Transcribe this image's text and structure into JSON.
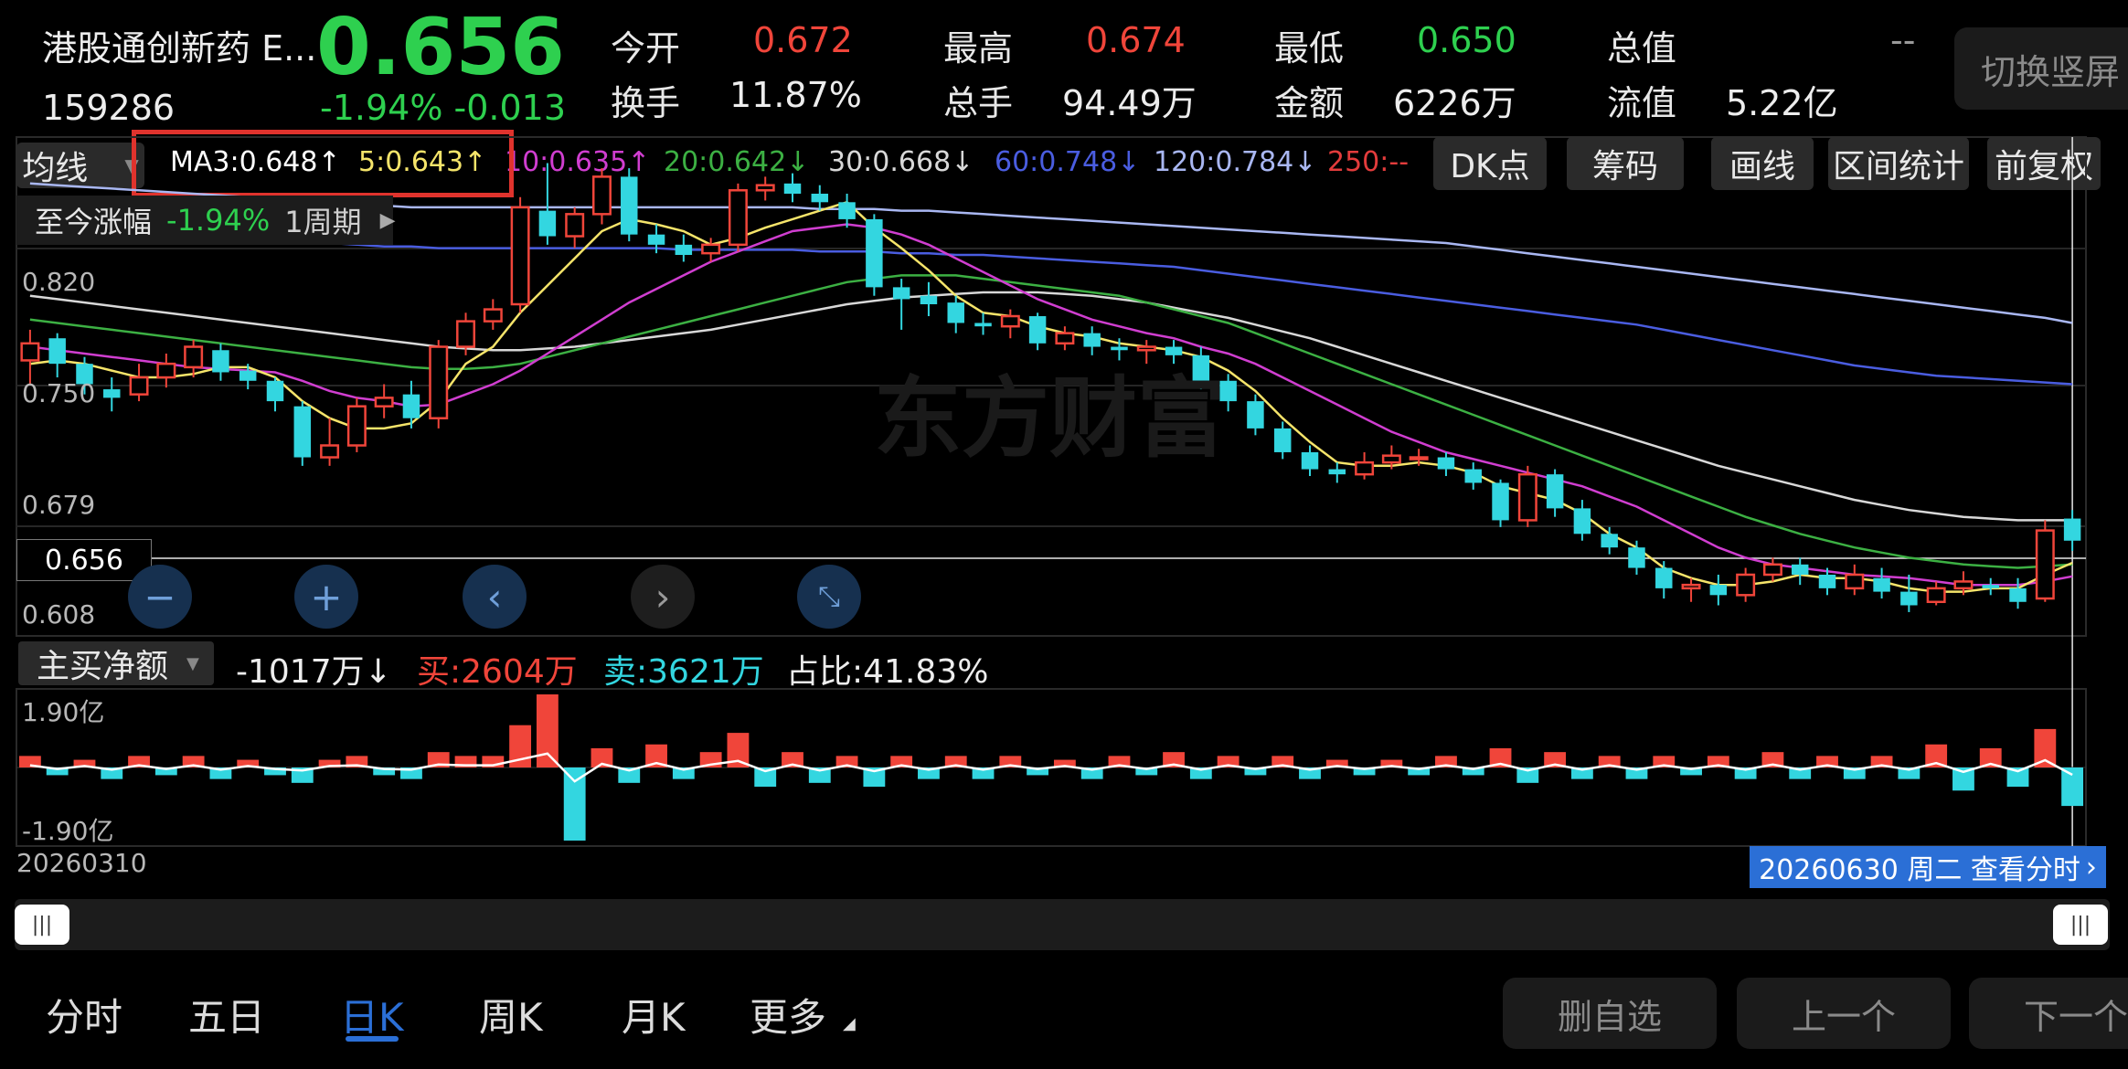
{
  "header": {
    "name": "港股通创新药 E...",
    "code": "159286",
    "price": "0.656",
    "change": "-1.94%  -0.013",
    "stats": [
      {
        "label": "今开",
        "value": "0.672",
        "color": "#f0453a"
      },
      {
        "label": "最高",
        "value": "0.674",
        "color": "#f0453a"
      },
      {
        "label": "最低",
        "value": "0.650",
        "color": "#2ed04f"
      },
      {
        "label": "总值",
        "value": "--",
        "color": "#9a9a9a"
      },
      {
        "label": "换手",
        "value": "11.87%",
        "color": "#ededed"
      },
      {
        "label": "总手",
        "value": "94.49万",
        "color": "#ededed"
      },
      {
        "label": "金额",
        "value": "6226万",
        "color": "#ededed"
      },
      {
        "label": "流值",
        "value": "5.22亿",
        "color": "#ededed"
      }
    ],
    "switch_label": "切换竖屏"
  },
  "toolbar": {
    "ma_button": "均线",
    "ma_values": [
      {
        "text": "MA3:0.648↑",
        "color": "#ffffff"
      },
      {
        "text": "5:0.643↑",
        "color": "#f5e46a"
      },
      {
        "text": "10:0.635↑",
        "color": "#d03ed0"
      },
      {
        "text": "20:0.642↓",
        "color": "#3cb043"
      },
      {
        "text": "30:0.668↓",
        "color": "#d8d8d8"
      },
      {
        "text": "60:0.748↓",
        "color": "#4a5de0"
      },
      {
        "text": "120:0.784↓",
        "color": "#a9b7f2"
      },
      {
        "text": "250:--",
        "color": "#e33c3c"
      }
    ],
    "buttons": [
      "DK点",
      "筹码",
      "画线",
      "区间统计",
      "前复权"
    ]
  },
  "range_info": {
    "label": "至今涨幅",
    "value": "-1.94%",
    "period": "1周期"
  },
  "price_axis": [
    "0.820",
    "0.750",
    "0.679",
    "0.608"
  ],
  "cursor_price": "0.656",
  "watermark": "东方财富",
  "indicator": {
    "select": "主买净额",
    "net": "-1017万↓",
    "buy": "买:2604万",
    "sell": "卖:3621万",
    "ratio": "占比:41.83%",
    "axis_top": "1.90亿",
    "axis_bottom": "-1.90亿"
  },
  "date_start": "20260310",
  "date_cursor": "20260630 周二 查看分时",
  "bottom_tabs": [
    "分时",
    "五日",
    "日K",
    "周K",
    "月K",
    "更多"
  ],
  "active_tab": "日K",
  "bottom_buttons": [
    "删自选",
    "上一个",
    "下一个"
  ],
  "colors": {
    "up": "#f0453a",
    "down": "#33d6e0",
    "ma3": "#ffffff",
    "ma5": "#f5e46a",
    "ma10": "#d03ed0",
    "ma20": "#3cb043",
    "ma30": "#d8d8d8",
    "ma60": "#4a5de0",
    "ma120": "#a9b7f2"
  },
  "chart_data": {
    "type": "candlestick",
    "ylim": [
      0.6,
      0.86
    ],
    "candles": [
      [
        0.762,
        0.772,
        0.748,
        0.78
      ],
      [
        0.775,
        0.76,
        0.752,
        0.778
      ],
      [
        0.76,
        0.748,
        0.742,
        0.764
      ],
      [
        0.745,
        0.74,
        0.732,
        0.752
      ],
      [
        0.742,
        0.752,
        0.738,
        0.76
      ],
      [
        0.752,
        0.76,
        0.746,
        0.766
      ],
      [
        0.758,
        0.77,
        0.752,
        0.774
      ],
      [
        0.768,
        0.755,
        0.75,
        0.772
      ],
      [
        0.756,
        0.75,
        0.745,
        0.76
      ],
      [
        0.75,
        0.738,
        0.732,
        0.752
      ],
      [
        0.735,
        0.705,
        0.7,
        0.738
      ],
      [
        0.705,
        0.712,
        0.7,
        0.728
      ],
      [
        0.712,
        0.735,
        0.708,
        0.74
      ],
      [
        0.735,
        0.74,
        0.728,
        0.748
      ],
      [
        0.742,
        0.728,
        0.722,
        0.75
      ],
      [
        0.728,
        0.77,
        0.722,
        0.774
      ],
      [
        0.77,
        0.785,
        0.765,
        0.79
      ],
      [
        0.785,
        0.792,
        0.78,
        0.798
      ],
      [
        0.795,
        0.852,
        0.79,
        0.858
      ],
      [
        0.85,
        0.835,
        0.83,
        0.878
      ],
      [
        0.835,
        0.848,
        0.828,
        0.852
      ],
      [
        0.848,
        0.87,
        0.842,
        0.875
      ],
      [
        0.87,
        0.836,
        0.832,
        0.875
      ],
      [
        0.836,
        0.83,
        0.825,
        0.842
      ],
      [
        0.83,
        0.824,
        0.82,
        0.836
      ],
      [
        0.825,
        0.83,
        0.82,
        0.834
      ],
      [
        0.83,
        0.862,
        0.826,
        0.866
      ],
      [
        0.862,
        0.865,
        0.856,
        0.87
      ],
      [
        0.866,
        0.86,
        0.855,
        0.872
      ],
      [
        0.86,
        0.855,
        0.85,
        0.865
      ],
      [
        0.855,
        0.845,
        0.84,
        0.86
      ],
      [
        0.845,
        0.805,
        0.8,
        0.848
      ],
      [
        0.805,
        0.798,
        0.78,
        0.81
      ],
      [
        0.8,
        0.795,
        0.788,
        0.808
      ],
      [
        0.796,
        0.784,
        0.778,
        0.8
      ],
      [
        0.784,
        0.782,
        0.777,
        0.79
      ],
      [
        0.782,
        0.788,
        0.775,
        0.792
      ],
      [
        0.788,
        0.772,
        0.768,
        0.79
      ],
      [
        0.772,
        0.778,
        0.768,
        0.782
      ],
      [
        0.778,
        0.77,
        0.765,
        0.782
      ],
      [
        0.77,
        0.768,
        0.762,
        0.775
      ],
      [
        0.768,
        0.77,
        0.76,
        0.774
      ],
      [
        0.77,
        0.765,
        0.76,
        0.774
      ],
      [
        0.765,
        0.75,
        0.745,
        0.77
      ],
      [
        0.75,
        0.738,
        0.732,
        0.754
      ],
      [
        0.738,
        0.722,
        0.718,
        0.742
      ],
      [
        0.722,
        0.708,
        0.704,
        0.726
      ],
      [
        0.708,
        0.698,
        0.694,
        0.712
      ],
      [
        0.698,
        0.695,
        0.69,
        0.702
      ],
      [
        0.695,
        0.702,
        0.692,
        0.708
      ],
      [
        0.702,
        0.706,
        0.698,
        0.712
      ],
      [
        0.705,
        0.705,
        0.7,
        0.71
      ],
      [
        0.705,
        0.698,
        0.694,
        0.708
      ],
      [
        0.698,
        0.69,
        0.686,
        0.702
      ],
      [
        0.69,
        0.668,
        0.664,
        0.692
      ],
      [
        0.668,
        0.695,
        0.664,
        0.7
      ],
      [
        0.695,
        0.675,
        0.67,
        0.698
      ],
      [
        0.675,
        0.66,
        0.656,
        0.68
      ],
      [
        0.66,
        0.652,
        0.648,
        0.664
      ],
      [
        0.652,
        0.64,
        0.636,
        0.656
      ],
      [
        0.64,
        0.628,
        0.622,
        0.644
      ],
      [
        0.628,
        0.63,
        0.62,
        0.634
      ],
      [
        0.63,
        0.624,
        0.618,
        0.636
      ],
      [
        0.624,
        0.636,
        0.62,
        0.64
      ],
      [
        0.636,
        0.642,
        0.632,
        0.646
      ],
      [
        0.642,
        0.636,
        0.63,
        0.646
      ],
      [
        0.636,
        0.628,
        0.624,
        0.64
      ],
      [
        0.628,
        0.636,
        0.624,
        0.642
      ],
      [
        0.634,
        0.626,
        0.622,
        0.64
      ],
      [
        0.626,
        0.618,
        0.614,
        0.636
      ],
      [
        0.62,
        0.628,
        0.618,
        0.632
      ],
      [
        0.628,
        0.632,
        0.624,
        0.638
      ],
      [
        0.63,
        0.628,
        0.624,
        0.634
      ],
      [
        0.628,
        0.62,
        0.616,
        0.634
      ],
      [
        0.622,
        0.662,
        0.62,
        0.668
      ],
      [
        0.669,
        0.656,
        0.65,
        0.674
      ]
    ],
    "ma5": [
      0.76,
      0.762,
      0.76,
      0.756,
      0.752,
      0.752,
      0.754,
      0.758,
      0.758,
      0.752,
      0.738,
      0.728,
      0.722,
      0.722,
      0.725,
      0.738,
      0.76,
      0.77,
      0.79,
      0.806,
      0.822,
      0.838,
      0.845,
      0.842,
      0.838,
      0.83,
      0.834,
      0.84,
      0.845,
      0.85,
      0.855,
      0.84,
      0.828,
      0.815,
      0.8,
      0.79,
      0.788,
      0.782,
      0.778,
      0.776,
      0.772,
      0.77,
      0.768,
      0.764,
      0.756,
      0.744,
      0.728,
      0.714,
      0.702,
      0.7,
      0.7,
      0.702,
      0.7,
      0.696,
      0.688,
      0.684,
      0.68,
      0.672,
      0.66,
      0.652,
      0.64,
      0.634,
      0.63,
      0.63,
      0.632,
      0.636,
      0.634,
      0.634,
      0.632,
      0.628,
      0.626,
      0.626,
      0.628,
      0.628,
      0.636,
      0.643
    ],
    "ma10": [
      0.77,
      0.768,
      0.766,
      0.764,
      0.762,
      0.76,
      0.758,
      0.757,
      0.756,
      0.755,
      0.75,
      0.744,
      0.74,
      0.738,
      0.735,
      0.736,
      0.742,
      0.748,
      0.756,
      0.766,
      0.776,
      0.786,
      0.796,
      0.804,
      0.812,
      0.82,
      0.826,
      0.832,
      0.838,
      0.84,
      0.842,
      0.84,
      0.836,
      0.83,
      0.822,
      0.814,
      0.806,
      0.798,
      0.792,
      0.786,
      0.782,
      0.778,
      0.775,
      0.77,
      0.766,
      0.76,
      0.752,
      0.744,
      0.736,
      0.728,
      0.72,
      0.714,
      0.708,
      0.704,
      0.7,
      0.696,
      0.692,
      0.688,
      0.682,
      0.676,
      0.668,
      0.66,
      0.652,
      0.646,
      0.642,
      0.64,
      0.638,
      0.636,
      0.635,
      0.634,
      0.632,
      0.63,
      0.63,
      0.63,
      0.632,
      0.635
    ],
    "ma20": [
      0.786,
      0.784,
      0.782,
      0.78,
      0.778,
      0.776,
      0.774,
      0.772,
      0.77,
      0.768,
      0.766,
      0.764,
      0.762,
      0.76,
      0.758,
      0.757,
      0.757,
      0.758,
      0.76,
      0.764,
      0.768,
      0.772,
      0.776,
      0.78,
      0.784,
      0.788,
      0.792,
      0.796,
      0.8,
      0.804,
      0.808,
      0.81,
      0.812,
      0.812,
      0.812,
      0.81,
      0.808,
      0.806,
      0.804,
      0.802,
      0.8,
      0.796,
      0.792,
      0.788,
      0.784,
      0.778,
      0.772,
      0.766,
      0.76,
      0.754,
      0.748,
      0.742,
      0.736,
      0.73,
      0.724,
      0.718,
      0.712,
      0.706,
      0.7,
      0.694,
      0.688,
      0.682,
      0.676,
      0.67,
      0.665,
      0.66,
      0.656,
      0.652,
      0.649,
      0.646,
      0.644,
      0.642,
      0.641,
      0.64,
      0.641,
      0.642
    ],
    "ma30": [
      0.8,
      0.798,
      0.796,
      0.794,
      0.792,
      0.79,
      0.788,
      0.786,
      0.784,
      0.782,
      0.78,
      0.778,
      0.776,
      0.774,
      0.772,
      0.77,
      0.769,
      0.768,
      0.768,
      0.769,
      0.77,
      0.772,
      0.774,
      0.776,
      0.778,
      0.78,
      0.783,
      0.786,
      0.789,
      0.792,
      0.795,
      0.797,
      0.799,
      0.8,
      0.801,
      0.802,
      0.802,
      0.802,
      0.801,
      0.8,
      0.798,
      0.796,
      0.793,
      0.79,
      0.787,
      0.783,
      0.779,
      0.775,
      0.77,
      0.765,
      0.76,
      0.755,
      0.75,
      0.745,
      0.74,
      0.735,
      0.73,
      0.725,
      0.72,
      0.715,
      0.71,
      0.705,
      0.7,
      0.696,
      0.692,
      0.688,
      0.684,
      0.68,
      0.677,
      0.674,
      0.672,
      0.67,
      0.669,
      0.668,
      0.668,
      0.668
    ],
    "ma60": [
      0.842,
      0.841,
      0.84,
      0.839,
      0.838,
      0.837,
      0.836,
      0.835,
      0.834,
      0.833,
      0.832,
      0.831,
      0.83,
      0.829,
      0.829,
      0.828,
      0.828,
      0.828,
      0.828,
      0.828,
      0.828,
      0.828,
      0.828,
      0.828,
      0.827,
      0.827,
      0.827,
      0.827,
      0.827,
      0.826,
      0.826,
      0.826,
      0.825,
      0.825,
      0.824,
      0.824,
      0.823,
      0.822,
      0.821,
      0.82,
      0.819,
      0.818,
      0.817,
      0.815,
      0.813,
      0.811,
      0.809,
      0.807,
      0.805,
      0.803,
      0.801,
      0.799,
      0.797,
      0.795,
      0.793,
      0.791,
      0.789,
      0.787,
      0.785,
      0.783,
      0.78,
      0.777,
      0.774,
      0.771,
      0.768,
      0.765,
      0.762,
      0.759,
      0.757,
      0.755,
      0.753,
      0.752,
      0.751,
      0.75,
      0.749,
      0.748
    ],
    "ma120": [
      0.866,
      0.865,
      0.864,
      0.863,
      0.862,
      0.861,
      0.86,
      0.859,
      0.858,
      0.857,
      0.856,
      0.855,
      0.854,
      0.853,
      0.852,
      0.852,
      0.852,
      0.852,
      0.852,
      0.852,
      0.852,
      0.852,
      0.852,
      0.852,
      0.852,
      0.852,
      0.852,
      0.852,
      0.852,
      0.851,
      0.851,
      0.851,
      0.85,
      0.85,
      0.849,
      0.848,
      0.847,
      0.846,
      0.845,
      0.844,
      0.843,
      0.842,
      0.841,
      0.84,
      0.839,
      0.838,
      0.837,
      0.836,
      0.835,
      0.834,
      0.833,
      0.832,
      0.831,
      0.829,
      0.827,
      0.825,
      0.823,
      0.821,
      0.819,
      0.817,
      0.815,
      0.813,
      0.811,
      0.809,
      0.807,
      0.805,
      0.803,
      0.801,
      0.799,
      0.797,
      0.795,
      0.793,
      0.791,
      0.789,
      0.787,
      0.784
    ],
    "flow_ylim": [
      -1.9,
      1.9
    ],
    "flow": [
      0.3,
      -0.2,
      0.2,
      -0.3,
      0.3,
      -0.2,
      0.3,
      -0.3,
      0.2,
      -0.2,
      -0.4,
      0.2,
      0.3,
      -0.2,
      -0.3,
      0.4,
      0.3,
      0.3,
      1.1,
      1.9,
      -1.9,
      0.5,
      -0.4,
      0.6,
      -0.3,
      0.4,
      0.9,
      -0.5,
      0.4,
      -0.4,
      0.3,
      -0.5,
      0.3,
      -0.3,
      0.3,
      -0.3,
      0.3,
      -0.2,
      0.2,
      -0.3,
      0.3,
      -0.2,
      0.4,
      -0.3,
      0.3,
      -0.2,
      0.3,
      -0.3,
      0.2,
      -0.2,
      0.2,
      -0.2,
      0.3,
      -0.2,
      0.5,
      -0.4,
      0.4,
      -0.3,
      0.3,
      -0.3,
      0.3,
      -0.2,
      0.3,
      -0.3,
      0.4,
      -0.3,
      0.3,
      -0.3,
      0.3,
      -0.3,
      0.6,
      -0.6,
      0.5,
      -0.5,
      1.0,
      -1.0
    ]
  }
}
